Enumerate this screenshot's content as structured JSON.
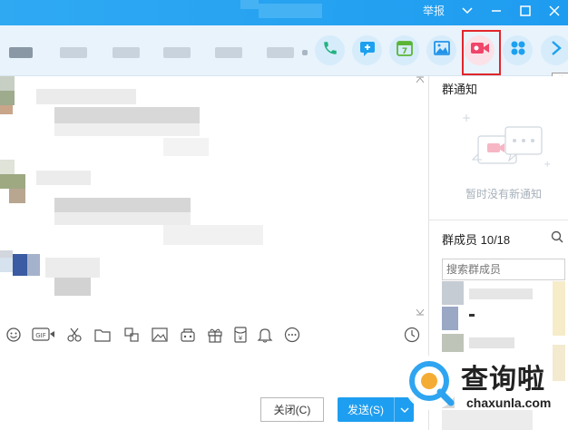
{
  "titlebar": {
    "report": "举报",
    "controls": [
      "chevron-down",
      "minimize",
      "maximize",
      "close"
    ]
  },
  "toolbar": {
    "tabs": [
      "",
      "",
      "",
      "",
      "",
      ""
    ],
    "tools": [
      {
        "name": "phone-icon",
        "color": "#23b27f"
      },
      {
        "name": "chat-plus-icon",
        "color": "#1ca0ef"
      },
      {
        "name": "calendar-icon",
        "color": "#5bb534",
        "text": "7"
      },
      {
        "name": "image-icon",
        "color": "#2293e8"
      },
      {
        "name": "video-icon",
        "color": "#f0456a"
      },
      {
        "name": "apps-icon",
        "color": "#1ca0ef"
      },
      {
        "name": "more-arrow-icon",
        "color": "#1ca0ef"
      }
    ],
    "tooltip": "收"
  },
  "input_toolbar": {
    "icons": [
      "emoji-icon",
      "gif-icon",
      "scissors-icon",
      "folder-icon",
      "font-icon",
      "picture-icon",
      "gallery-icon",
      "gift-icon",
      "red-packet-icon",
      "bell-icon",
      "more-icon"
    ],
    "gif_label": "GIF"
  },
  "buttons": {
    "close": "关闭(C)",
    "send": "发送(S)"
  },
  "panel": {
    "notice_title": "群通知",
    "notice_empty": "暂时没有新通知",
    "members_title": "群成员 10/18",
    "member_search_placeholder": "搜索群成员"
  },
  "watermark": {
    "main": "查询啦",
    "sub": "chaxunla.com"
  },
  "colors": {
    "titlebar": "#1e9cf0",
    "toolbar_bg": "#e9f3fc",
    "highlight_box": "#e0262b",
    "send_button": "#1e9ef0"
  }
}
